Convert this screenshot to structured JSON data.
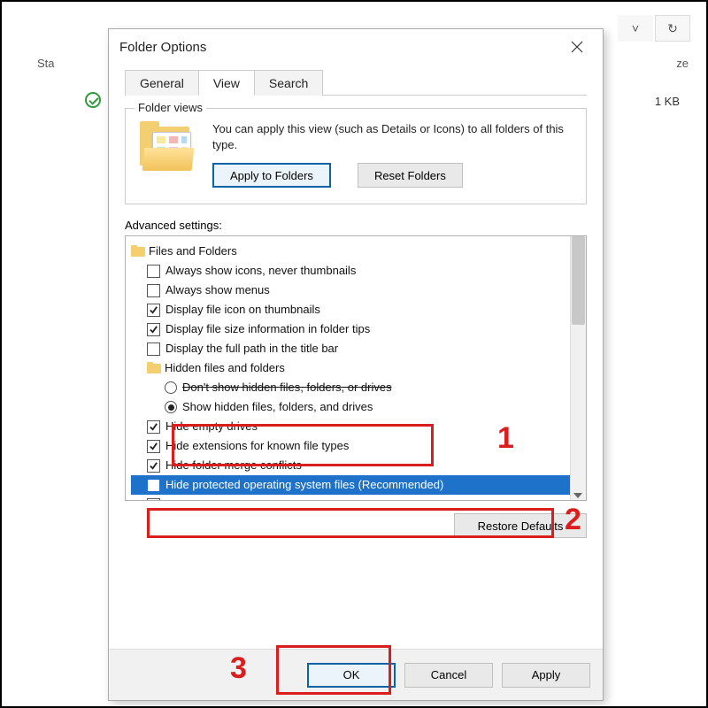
{
  "background": {
    "left_trunc": "Sta",
    "right_trunc": "ze",
    "size_col": "1 KB"
  },
  "dialog": {
    "title": "Folder Options",
    "tabs": {
      "general": "General",
      "view": "View",
      "search": "Search"
    },
    "group_legend": "Folder views",
    "fv_text": "You can apply this view (such as Details or Icons) to all folders of this type.",
    "apply_folders": "Apply to Folders",
    "reset_folders": "Reset Folders",
    "advanced_label": "Advanced settings:",
    "tree": {
      "root": "Files and Folders",
      "cb0": "Always show icons, never thumbnails",
      "cb1": "Always show menus",
      "cb2": "Display file icon on thumbnails",
      "cb3": "Display file size information in folder tips",
      "cb4": "Display the full path in the title bar",
      "sub": "Hidden files and folders",
      "rb0": "Don't show hidden files, folders, or drives",
      "rb1": "Show hidden files, folders, and drives",
      "cb5": "Hide empty drives",
      "cb6": "Hide extensions for known file types",
      "cb7": "Hide folder merge conflicts",
      "cb8": "Hide protected operating system files (Recommended)"
    },
    "restore": "Restore Defaults",
    "ok": "OK",
    "cancel": "Cancel",
    "apply": "Apply"
  },
  "annotations": {
    "n1": "1",
    "n2": "2",
    "n3": "3"
  }
}
